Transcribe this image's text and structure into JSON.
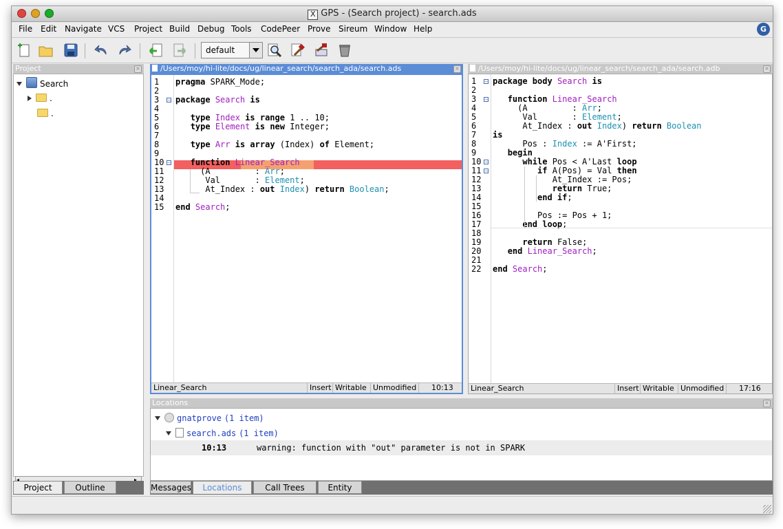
{
  "window": {
    "title": "GPS - (Search project) - search.ads"
  },
  "menu": [
    "File",
    "Edit",
    "Navigate",
    "VCS",
    "Project",
    "Build",
    "Debug",
    "Tools",
    "CodePeer",
    "Prove",
    "Sireum",
    "Window",
    "Help"
  ],
  "toolbar": {
    "build_mode": "default"
  },
  "project_panel": {
    "title": "Project",
    "root": "Search",
    "children": [
      ".",
      "."
    ],
    "tabs": [
      "Project",
      "Outline"
    ]
  },
  "editor_left": {
    "path": "/Users/moy/hi-lite/docs/ug/linear_search/search_ada/search.ads",
    "lines": [
      {
        "n": "1",
        "segs": [
          [
            "kw",
            "pragma"
          ],
          [
            "t",
            " SPARK_Mode;"
          ]
        ]
      },
      {
        "n": "2",
        "segs": []
      },
      {
        "n": "3",
        "segs": [
          [
            "kw",
            "package"
          ],
          [
            "t",
            " "
          ],
          [
            "id",
            "Search"
          ],
          [
            "t",
            " "
          ],
          [
            "kw",
            "is"
          ]
        ]
      },
      {
        "n": "4",
        "segs": []
      },
      {
        "n": "5",
        "segs": [
          [
            "t",
            "   "
          ],
          [
            "kw",
            "type"
          ],
          [
            "t",
            " "
          ],
          [
            "id",
            "Index"
          ],
          [
            "t",
            " "
          ],
          [
            "kw",
            "is range"
          ],
          [
            "t",
            " 1 .. 10;"
          ]
        ]
      },
      {
        "n": "6",
        "segs": [
          [
            "t",
            "   "
          ],
          [
            "kw",
            "type"
          ],
          [
            "t",
            " "
          ],
          [
            "id",
            "Element"
          ],
          [
            "t",
            " "
          ],
          [
            "kw",
            "is new"
          ],
          [
            "t",
            " Integer;"
          ]
        ]
      },
      {
        "n": "7",
        "segs": []
      },
      {
        "n": "8",
        "segs": [
          [
            "t",
            "   "
          ],
          [
            "kw",
            "type"
          ],
          [
            "t",
            " "
          ],
          [
            "id",
            "Arr"
          ],
          [
            "t",
            " "
          ],
          [
            "kw",
            "is array"
          ],
          [
            "t",
            " (Index) "
          ],
          [
            "kw",
            "of"
          ],
          [
            "t",
            " Element;"
          ]
        ]
      },
      {
        "n": "9",
        "segs": []
      },
      {
        "n": "10",
        "segs": [
          [
            "t",
            "   "
          ],
          [
            "kw",
            "function"
          ],
          [
            "t",
            " "
          ],
          [
            "id",
            "Linear_Search"
          ]
        ]
      },
      {
        "n": "11",
        "segs": [
          [
            "t",
            "     (A         : "
          ],
          [
            "ty",
            "Arr"
          ],
          [
            "t",
            ";"
          ]
        ]
      },
      {
        "n": "12",
        "segs": [
          [
            "t",
            "      Val       : "
          ],
          [
            "ty",
            "Element"
          ],
          [
            "t",
            ";"
          ]
        ]
      },
      {
        "n": "13",
        "segs": [
          [
            "t",
            "      At_Index : "
          ],
          [
            "kw",
            "out"
          ],
          [
            "t",
            " "
          ],
          [
            "ty",
            "Index"
          ],
          [
            "t",
            ") "
          ],
          [
            "kw",
            "return"
          ],
          [
            "t",
            " "
          ],
          [
            "ty",
            "Boolean"
          ],
          [
            "t",
            ";"
          ]
        ]
      },
      {
        "n": "14",
        "segs": []
      },
      {
        "n": "15",
        "segs": [
          [
            "kw",
            "end"
          ],
          [
            "t",
            " "
          ],
          [
            "id",
            "Search"
          ],
          [
            "t",
            ";"
          ]
        ]
      }
    ],
    "status": {
      "entity": "Linear_Search",
      "mode": "Insert",
      "writable": "Writable",
      "modified": "Unmodified",
      "position": "10:13"
    }
  },
  "editor_right": {
    "path": "/Users/moy/hi-lite/docs/ug/linear_search/search_ada/search.adb",
    "lines": [
      {
        "n": "1",
        "segs": [
          [
            "kw",
            "package body"
          ],
          [
            "t",
            " "
          ],
          [
            "id",
            "Search"
          ],
          [
            "t",
            " "
          ],
          [
            "kw",
            "is"
          ]
        ]
      },
      {
        "n": "2",
        "segs": []
      },
      {
        "n": "3",
        "segs": [
          [
            "t",
            "   "
          ],
          [
            "kw",
            "function"
          ],
          [
            "t",
            " "
          ],
          [
            "id",
            "Linear_Search"
          ]
        ]
      },
      {
        "n": "4",
        "segs": [
          [
            "t",
            "     (A         : "
          ],
          [
            "ty",
            "Arr"
          ],
          [
            "t",
            ";"
          ]
        ]
      },
      {
        "n": "5",
        "segs": [
          [
            "t",
            "      Val       : "
          ],
          [
            "ty",
            "Element"
          ],
          [
            "t",
            ";"
          ]
        ]
      },
      {
        "n": "6",
        "segs": [
          [
            "t",
            "      At_Index : "
          ],
          [
            "kw",
            "out"
          ],
          [
            "t",
            " "
          ],
          [
            "ty",
            "Index"
          ],
          [
            "t",
            ") "
          ],
          [
            "kw",
            "return"
          ],
          [
            "t",
            " "
          ],
          [
            "ty",
            "Boolean"
          ]
        ]
      },
      {
        "n": "7",
        "segs": [
          [
            "kw",
            "is"
          ]
        ]
      },
      {
        "n": "8",
        "segs": [
          [
            "t",
            "      Pos : "
          ],
          [
            "ty",
            "Index"
          ],
          [
            "t",
            " := A'First;"
          ]
        ]
      },
      {
        "n": "9",
        "segs": [
          [
            "t",
            "   "
          ],
          [
            "kw",
            "begin"
          ]
        ]
      },
      {
        "n": "10",
        "segs": [
          [
            "t",
            "      "
          ],
          [
            "kw",
            "while"
          ],
          [
            "t",
            " Pos < A'Last "
          ],
          [
            "kw",
            "loop"
          ]
        ]
      },
      {
        "n": "11",
        "segs": [
          [
            "t",
            "         "
          ],
          [
            "kw",
            "if"
          ],
          [
            "t",
            " A(Pos) = Val "
          ],
          [
            "kw",
            "then"
          ]
        ]
      },
      {
        "n": "12",
        "segs": [
          [
            "t",
            "            At_Index := Pos;"
          ]
        ]
      },
      {
        "n": "13",
        "segs": [
          [
            "t",
            "            "
          ],
          [
            "kw",
            "return"
          ],
          [
            "t",
            " True;"
          ]
        ]
      },
      {
        "n": "14",
        "segs": [
          [
            "t",
            "         "
          ],
          [
            "kw",
            "end if"
          ],
          [
            "t",
            ";"
          ]
        ]
      },
      {
        "n": "15",
        "segs": []
      },
      {
        "n": "16",
        "segs": [
          [
            "t",
            "         Pos := Pos + 1;"
          ]
        ]
      },
      {
        "n": "17",
        "segs": [
          [
            "t",
            "      "
          ],
          [
            "kw",
            "end loop"
          ],
          [
            "t",
            ";"
          ]
        ]
      },
      {
        "n": "18",
        "segs": []
      },
      {
        "n": "19",
        "segs": [
          [
            "t",
            "      "
          ],
          [
            "kw",
            "return"
          ],
          [
            "t",
            " False;"
          ]
        ]
      },
      {
        "n": "20",
        "segs": [
          [
            "t",
            "   "
          ],
          [
            "kw",
            "end"
          ],
          [
            "t",
            " "
          ],
          [
            "id",
            "Linear_Search"
          ],
          [
            "t",
            ";"
          ]
        ]
      },
      {
        "n": "21",
        "segs": []
      },
      {
        "n": "22",
        "segs": [
          [
            "kw",
            "end"
          ],
          [
            "t",
            " "
          ],
          [
            "id",
            "Search"
          ],
          [
            "t",
            ";"
          ]
        ]
      }
    ],
    "status": {
      "entity": "Linear_Search",
      "mode": "Insert",
      "writable": "Writable",
      "modified": "Unmodified",
      "position": "17:16"
    }
  },
  "locations": {
    "title": "Locations",
    "category": "gnatprove",
    "category_count": "(1 item)",
    "file": "search.ads",
    "file_count": "(1 item)",
    "msg_pos": "10:13",
    "msg_text": "warning: function with \"out\" parameter is not in SPARK",
    "tabs": [
      "Messages",
      "Locations",
      "Call Trees",
      "Entity"
    ]
  },
  "colors": {
    "accent": "#5b8cd6",
    "keyword_id": "#a020c0",
    "type": "#1e90b0",
    "error_line": "#f26060"
  }
}
